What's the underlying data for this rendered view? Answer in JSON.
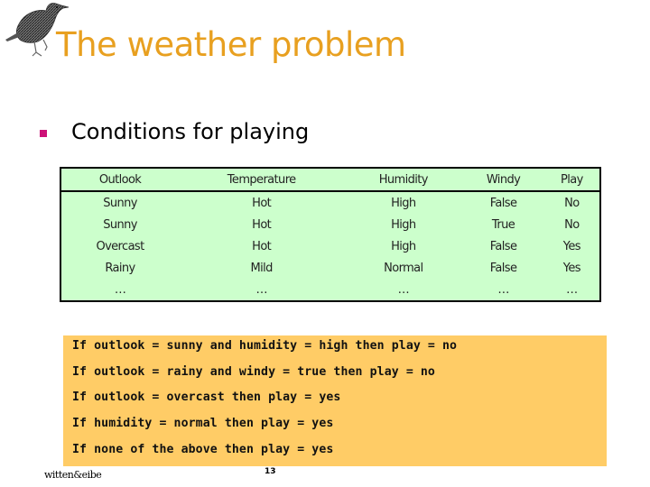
{
  "slide": {
    "title": "The weather problem",
    "logo_icon": "bird-logo-icon",
    "bullet": {
      "icon": "square-bullet-icon",
      "text": "Conditions for playing"
    },
    "table": {
      "headers": [
        "Outlook",
        "Temperature",
        "Humidity",
        "Windy",
        "Play"
      ],
      "rows": [
        [
          "Sunny",
          "Hot",
          "High",
          "False",
          "No"
        ],
        [
          "Sunny",
          "Hot",
          "High",
          "True",
          "No"
        ],
        [
          "Overcast",
          "Hot",
          "High",
          "False",
          "Yes"
        ],
        [
          "Rainy",
          "Mild",
          "Normal",
          "False",
          "Yes"
        ],
        [
          "…",
          "…",
          "…",
          "…",
          "…"
        ]
      ]
    },
    "rules": [
      "If outlook = sunny and humidity = high then play = no",
      "If outlook = rainy and windy = true then play = no",
      "If outlook = overcast then play = yes",
      "If humidity = normal then play = yes",
      "If none of the above then play = yes"
    ],
    "footer": {
      "author": "witten&eibe",
      "page_number": "13"
    },
    "colors": {
      "title": "#E8A020",
      "bullet": "#CC1177",
      "table_bg": "#CCFFCC",
      "rules_bg": "#FFCC66"
    }
  }
}
